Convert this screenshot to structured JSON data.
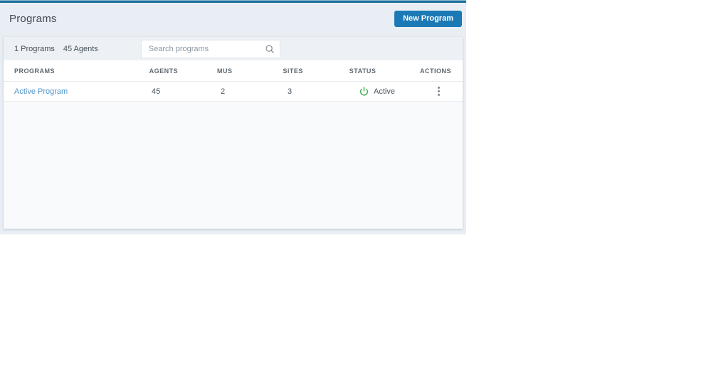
{
  "page": {
    "title": "Programs"
  },
  "header": {
    "new_program_button": "New Program"
  },
  "summary": {
    "programs_count": "1 Programs",
    "agents_count": "45 Agents"
  },
  "search": {
    "placeholder": "Search programs",
    "value": "",
    "icon": "search-icon"
  },
  "table": {
    "columns": [
      "PROGRAMS",
      "AGENTS",
      "MUS",
      "SITES",
      "STATUS",
      "ACTIONS"
    ],
    "rows": [
      {
        "program": "Active Program",
        "agents": "45",
        "mus": "2",
        "sites": "3",
        "status": "Active",
        "status_icon": "power-icon",
        "actions_icon": "kebab-menu-icon"
      }
    ]
  },
  "colors": {
    "topbar": "#20719d",
    "page_background": "#e9eef4",
    "primary_button": "#1b79b5",
    "link": "#4d94c7",
    "status_active": "#3cb04a"
  }
}
